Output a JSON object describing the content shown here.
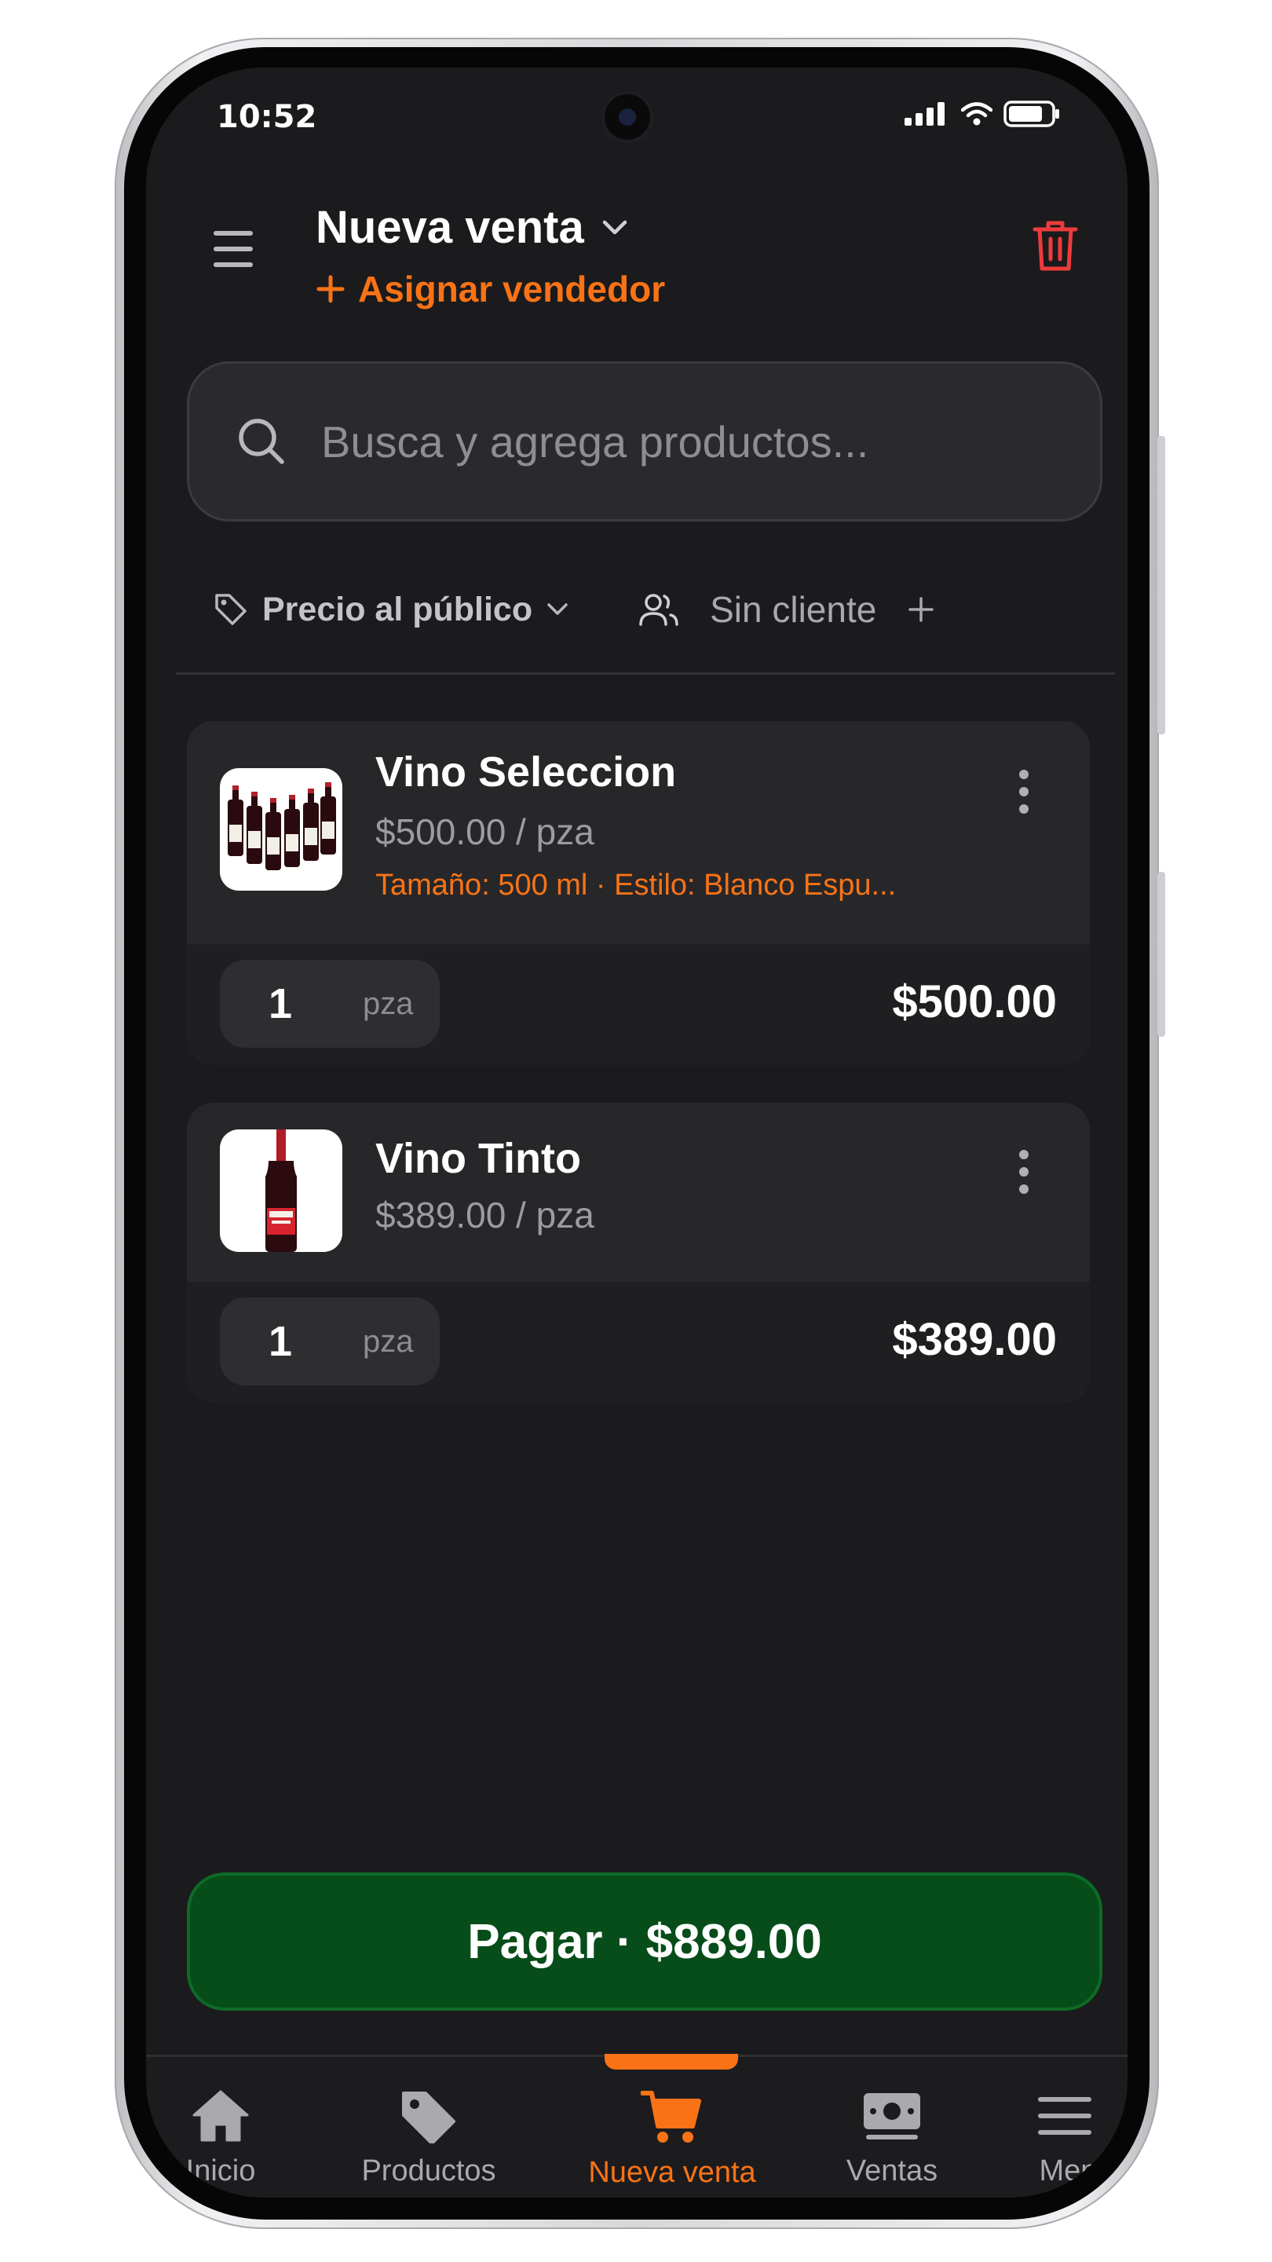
{
  "status_bar": {
    "time": "10:52"
  },
  "header": {
    "title": "Nueva venta",
    "assign_seller": "Asignar vendedor"
  },
  "search": {
    "placeholder": "Busca y agrega productos..."
  },
  "filters": {
    "price_list": "Precio al público",
    "client": "Sin cliente"
  },
  "cart": {
    "items": [
      {
        "name": "Vino Seleccion",
        "unit_price": "$500.00 / pza",
        "variant": "Tamaño: 500 ml · Estilo: Blanco Espu...",
        "quantity": "1",
        "unit": "pza",
        "line_total": "$500.00"
      },
      {
        "name": "Vino Tinto",
        "unit_price": "$389.00 / pza",
        "quantity": "1",
        "unit": "pza",
        "line_total": "$389.00"
      }
    ]
  },
  "pay_button": {
    "label": "Pagar · $889.00"
  },
  "bottom_nav": {
    "items": [
      {
        "label": "Inicio",
        "icon": "home-icon"
      },
      {
        "label": "Productos",
        "icon": "tag-icon"
      },
      {
        "label": "Nueva venta",
        "icon": "cart-icon",
        "active": true
      },
      {
        "label": "Ventas",
        "icon": "cash-icon"
      },
      {
        "label": "Menú",
        "icon": "menu-icon"
      }
    ]
  },
  "colors": {
    "background": "#1b1b1d",
    "accent": "#f97316",
    "delete": "#ef3b3b",
    "pay_button": "#064d1a"
  }
}
